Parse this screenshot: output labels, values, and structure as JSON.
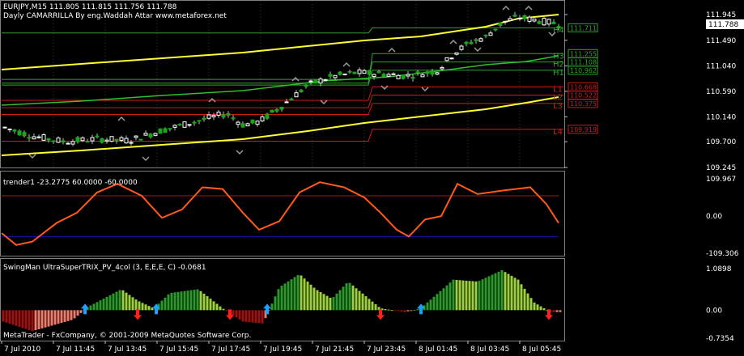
{
  "main": {
    "header_line": "EURJPY,M15  111.805 111.815 111.756 111.788",
    "subtitle": "Dayly CAMARRILLA By eng.Waddah Attar  www.metaforex.net",
    "current_price": "111.788",
    "y_ticks": [
      "111.945",
      "111.490",
      "111.040",
      "110.590",
      "110.140",
      "109.700",
      "109.245"
    ],
    "level_labels": [
      {
        "name": "H4",
        "value": "111.711",
        "color": "#2fa52f"
      },
      {
        "name": "H3",
        "value": "111.255",
        "color": "#2fa52f"
      },
      {
        "name": "H2",
        "value": "111.108",
        "color": "#2fa52f"
      },
      {
        "name": "H1",
        "value": "110.962",
        "color": "#2fa52f"
      },
      {
        "name": "L1",
        "value": "110.668",
        "color": "#d11b1b"
      },
      {
        "name": "L2",
        "value": "110.522",
        "color": "#d11b1b"
      },
      {
        "name": "L3",
        "value": "110.375",
        "color": "#d11b1b"
      },
      {
        "name": "L4",
        "value": "109.919",
        "color": "#d11b1b"
      }
    ]
  },
  "trender": {
    "label": "trender1 -23.2775 60.0000 -60.0000",
    "y_ticks": [
      "109.967",
      "0.00",
      "-109.306"
    ]
  },
  "trix": {
    "label": "SwingMan UltraSuperTRIX_PV_4col (3, E,E,E, C) -0.0681",
    "y_ticks": [
      "1.0898",
      "0.00",
      "-0.7354"
    ],
    "copyright": "MetaTrader - FxCompany, © 2001-2009 MetaQuotes Software Corp."
  },
  "time_axis": [
    "7 Jul 2010",
    "7 Jul 11:45",
    "7 Jul 13:45",
    "7 Jul 15:45",
    "7 Jul 17:45",
    "7 Jul 19:45",
    "7 Jul 21:45",
    "7 Jul 23:45",
    "8 Jul 01:45",
    "8 Jul 03:45",
    "8 Jul 05:45"
  ],
  "colors": {
    "bull": "#ffffff",
    "bear": "#1aa51a",
    "trender": "#ff5a1a",
    "up_arrow": "#1ea0ff",
    "down_arrow": "#ff2020"
  }
}
